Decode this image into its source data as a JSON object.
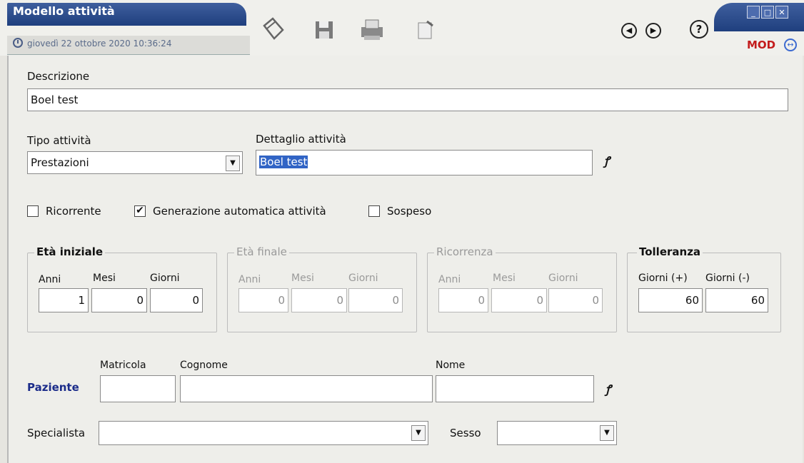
{
  "window": {
    "title": "Modello attività",
    "datetime": "giovedì 22 ottobre 2020   10:36:24",
    "mode": "MOD",
    "controls": {
      "minimize": "_",
      "maximize": "□",
      "close": "✕"
    }
  },
  "toolbar": {
    "icons": [
      "clipboard-icon",
      "save-icon",
      "print-icon",
      "edit-icon"
    ],
    "nav": {
      "back": "◀",
      "forward": "▶",
      "help": "?"
    }
  },
  "form": {
    "descrizione": {
      "label": "Descrizione",
      "value": "Boel test"
    },
    "tipo_attivita": {
      "label": "Tipo attività",
      "value": "Prestazioni"
    },
    "dettaglio_attivita": {
      "label": "Dettaglio attività",
      "value": "Boel test"
    },
    "checkboxes": [
      {
        "label": "Ricorrente",
        "checked": false
      },
      {
        "label": "Generazione automatica attività",
        "checked": true
      },
      {
        "label": "Sospeso",
        "checked": false
      }
    ],
    "eta_iniziale": {
      "title": "Età iniziale",
      "anni_label": "Anni",
      "mesi_label": "Mesi",
      "giorni_label": "Giorni",
      "anni": "1",
      "mesi": "0",
      "giorni": "0"
    },
    "eta_finale": {
      "title": "Età finale",
      "anni_label": "Anni",
      "mesi_label": "Mesi",
      "giorni_label": "Giorni",
      "anni": "0",
      "mesi": "0",
      "giorni": "0"
    },
    "ricorrenza": {
      "title": "Ricorrenza",
      "anni_label": "Anni",
      "mesi_label": "Mesi",
      "giorni_label": "Giorni",
      "anni": "0",
      "mesi": "0",
      "giorni": "0"
    },
    "tolleranza": {
      "title": "Tolleranza",
      "plus_label": "Giorni (+)",
      "minus_label": "Giorni (-)",
      "plus": "60",
      "minus": "60"
    },
    "paziente": {
      "label": "Paziente",
      "matricola_label": "Matricola",
      "cognome_label": "Cognome",
      "nome_label": "Nome",
      "matricola": "",
      "cognome": "",
      "nome": ""
    },
    "specialista": {
      "label": "Specialista",
      "value": ""
    },
    "sesso": {
      "label": "Sesso",
      "value": ""
    }
  }
}
